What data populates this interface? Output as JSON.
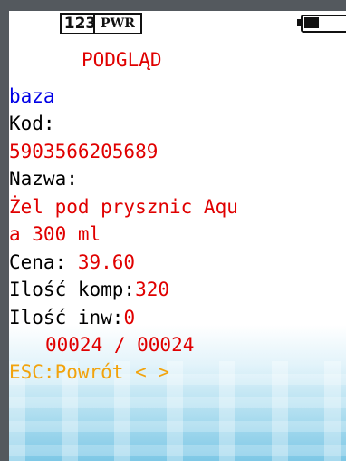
{
  "status": {
    "mode_badge": "123",
    "power_badge": "PWR",
    "battery_level": 0.35
  },
  "header": {
    "title": "PODGLĄD"
  },
  "record": {
    "source": "baza",
    "code_label": "Kod:",
    "code_value": "5903566205689",
    "name_label": "Nazwa:",
    "name_line1": "Żel pod prysznic Aqu",
    "name_line2": "a 300 ml",
    "price_label": "Cena: ",
    "price_value": "39.60",
    "qty_comp_label": "Ilość komp:",
    "qty_comp_value": "320",
    "qty_inv_label": "Ilość inw:",
    "qty_inv_value": "0"
  },
  "pager": {
    "text": "00024 / 00024"
  },
  "footer": {
    "hint": "ESC:Powrót < >"
  },
  "colors": {
    "label": "#000000",
    "value": "#e00000",
    "source": "#0000e6",
    "footer": "#f2a30d",
    "frame": "#54595e"
  }
}
